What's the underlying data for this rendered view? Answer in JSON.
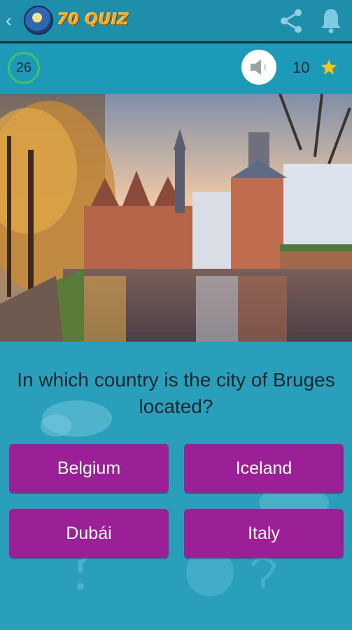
{
  "header": {
    "back_icon": "chevron-left-icon",
    "app_name": "70 QUIZ",
    "share_icon": "share-icon",
    "notification_icon": "bell-icon"
  },
  "status": {
    "timer": "26",
    "sound_icon": "speaker-icon",
    "score": "10",
    "score_icon": "star-icon"
  },
  "question": {
    "text": "In which country is the city of Bruges located?"
  },
  "answers": [
    {
      "label": "Belgium"
    },
    {
      "label": "Iceland"
    },
    {
      "label": "Dubái"
    },
    {
      "label": "Italy"
    }
  ],
  "colors": {
    "appbar": "#1f8eab",
    "background": "#2a9fbc",
    "answer_button": "#9b1f96",
    "timer_ring": "#43c06a",
    "logo_text": "#f7a91e",
    "star": "#f5c518"
  }
}
